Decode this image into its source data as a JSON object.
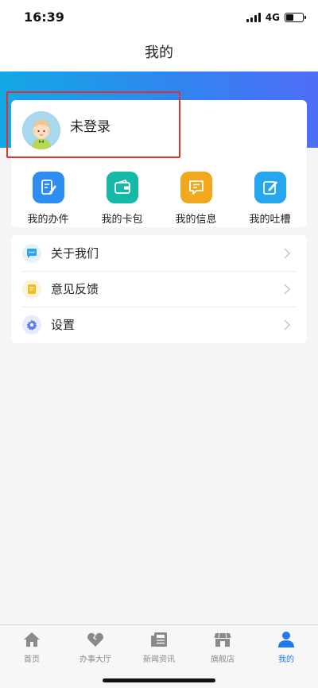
{
  "status": {
    "time": "16:39",
    "network": "4G",
    "battery_level": 0.45
  },
  "header": {
    "title": "我的"
  },
  "profile": {
    "login_text": "未登录",
    "avatar": "child-avatar-icon"
  },
  "quick_actions": [
    {
      "label": "我的办件",
      "icon": "document-edit-icon",
      "color": "#2d8df2"
    },
    {
      "label": "我的卡包",
      "icon": "wallet-icon",
      "color": "#16b9a8"
    },
    {
      "label": "我的信息",
      "icon": "message-icon",
      "color": "#f2a81d"
    },
    {
      "label": "我的吐槽",
      "icon": "edit-icon",
      "color": "#27a6f0"
    }
  ],
  "menu": [
    {
      "label": "关于我们",
      "icon": "chat-bubble-icon",
      "color": "#2aa4f2"
    },
    {
      "label": "意见反馈",
      "icon": "note-icon",
      "color": "#f4be27"
    },
    {
      "label": "设置",
      "icon": "gear-icon",
      "color": "#5b7cf0"
    }
  ],
  "tabbar": {
    "items": [
      {
        "label": "首页",
        "icon": "home-icon"
      },
      {
        "label": "办事大厅",
        "icon": "heart-icon"
      },
      {
        "label": "新闻资讯",
        "icon": "news-icon"
      },
      {
        "label": "旗舰店",
        "icon": "store-icon"
      },
      {
        "label": "我的",
        "icon": "person-icon"
      }
    ],
    "active_index": 4,
    "active_color": "#1f7bea",
    "inactive_color": "#8a8a8a"
  },
  "colors": {
    "accent": "#2f86f0",
    "highlight_border": "#e0302b"
  }
}
